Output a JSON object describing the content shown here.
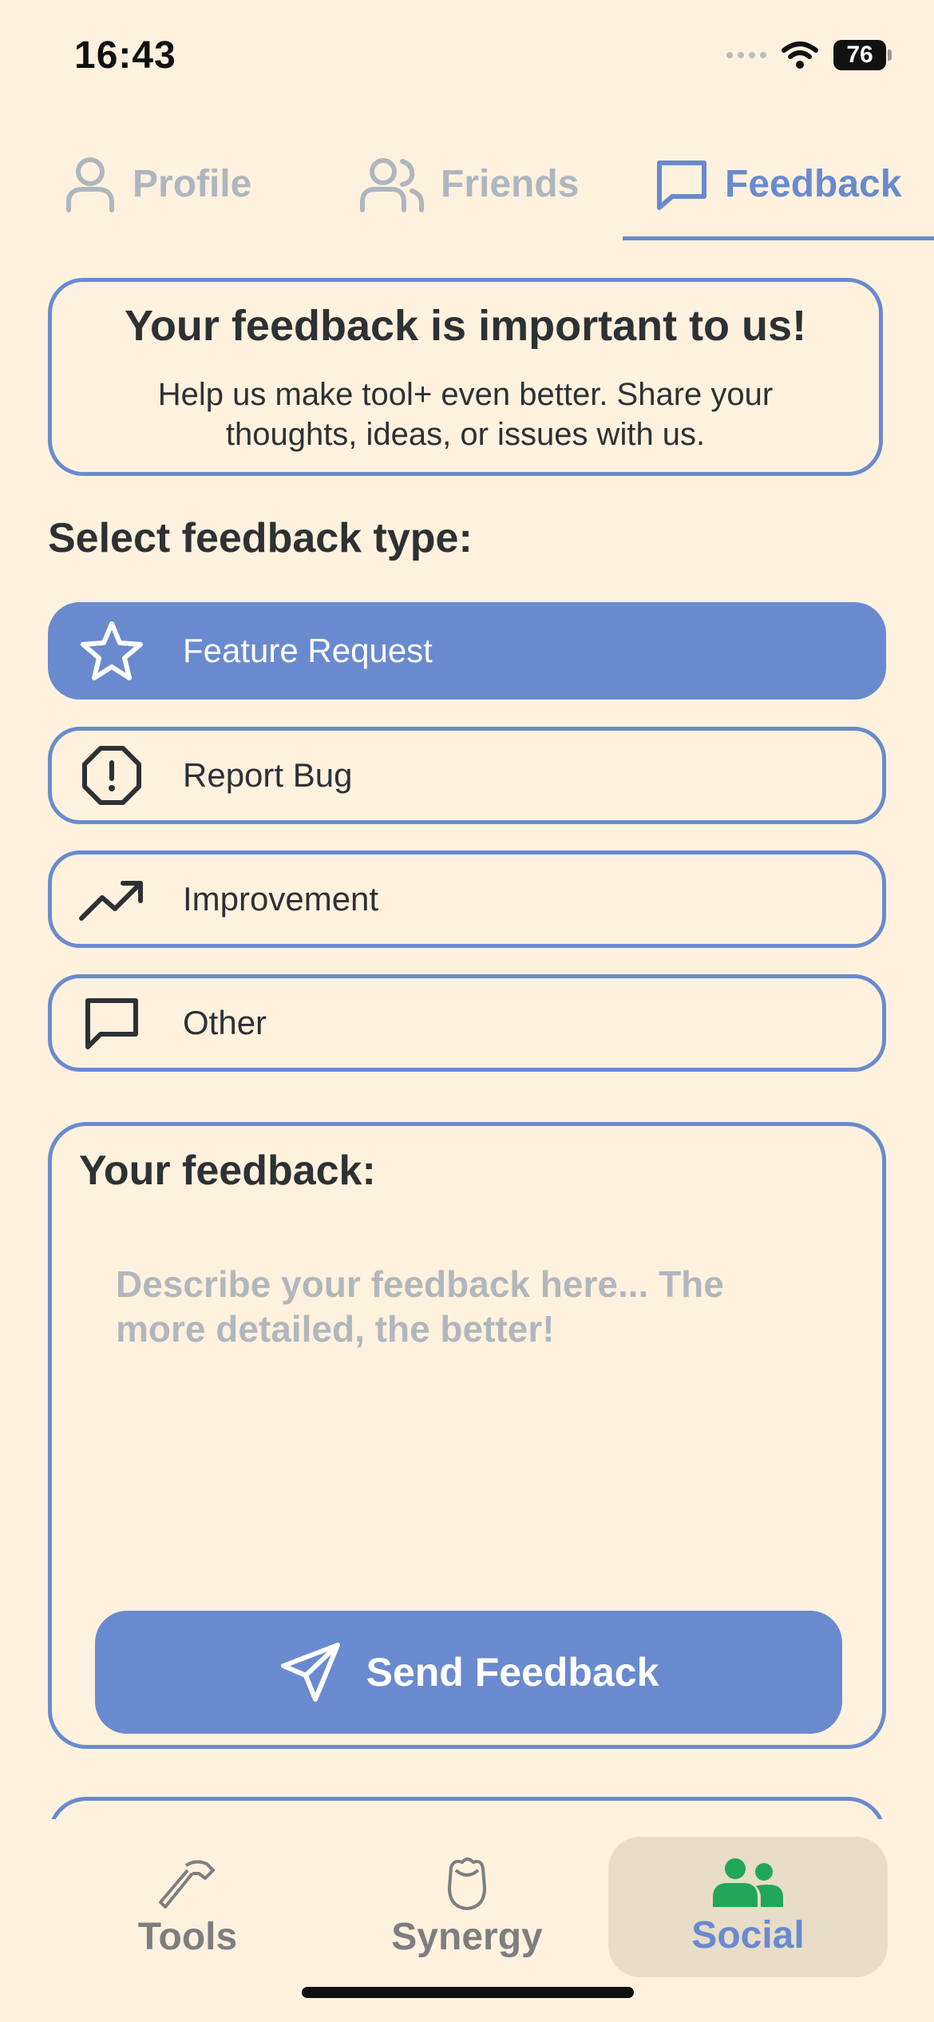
{
  "status_bar": {
    "time": "16:43",
    "battery": "76"
  },
  "top_tabs": [
    {
      "label": "Profile",
      "icon": "person-icon"
    },
    {
      "label": "Friends",
      "icon": "people-icon"
    },
    {
      "label": "Feedback",
      "icon": "chat-bubble-icon",
      "active": true
    }
  ],
  "info_card": {
    "title": "Your feedback is important to us!",
    "text": "Help us make tool+ even better. Share your thoughts, ideas, or issues with us."
  },
  "feedback_type": {
    "label": "Select feedback type:",
    "options": [
      {
        "label": "Feature Request",
        "icon": "star-icon",
        "selected": true
      },
      {
        "label": "Report Bug",
        "icon": "alert-octagon-icon"
      },
      {
        "label": "Improvement",
        "icon": "trending-up-icon"
      },
      {
        "label": "Other",
        "icon": "chat-bubble-icon"
      }
    ]
  },
  "feedback_form": {
    "title": "Your feedback:",
    "placeholder": "Describe your feedback here... The more detailed, the better!",
    "value": "",
    "send_label": "Send Feedback"
  },
  "bottom_nav": [
    {
      "label": "Tools",
      "icon": "hammer-icon"
    },
    {
      "label": "Synergy",
      "icon": "rose-icon"
    },
    {
      "label": "Social",
      "icon": "people-filled-icon",
      "active": true
    }
  ],
  "colors": {
    "background": "#FEF2DF",
    "accent": "#6A8ACF",
    "text": "#2E3133",
    "inactive": "#AEB6BF",
    "social_icon": "#22A65A"
  }
}
